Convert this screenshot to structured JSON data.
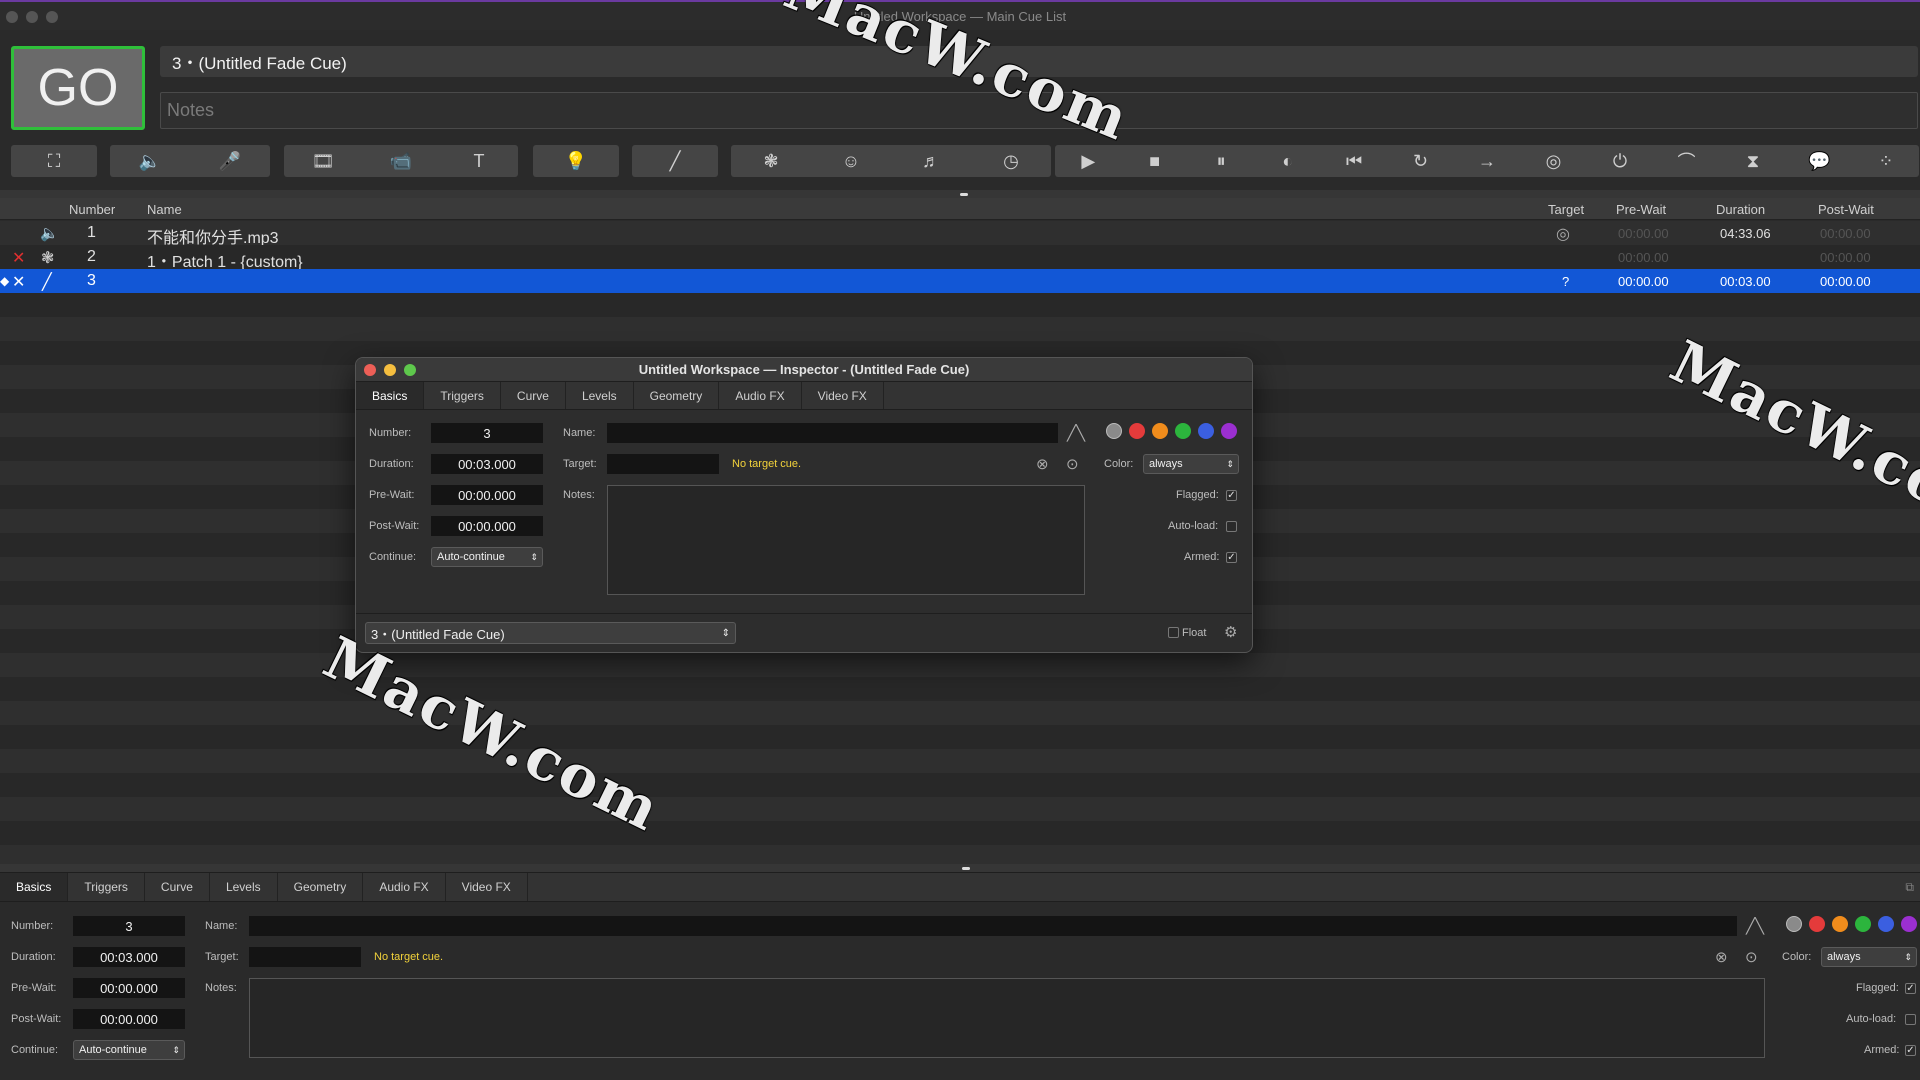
{
  "window": {
    "title": "Untitled Workspace — Main Cue List"
  },
  "go": {
    "label": "GO"
  },
  "current_cue": {
    "title": "3・(Untitled Fade Cue)",
    "notes_placeholder": "Notes"
  },
  "toolbar": {
    "icons": [
      "group",
      "audio",
      "mic",
      "video",
      "camera",
      "text",
      "light",
      "fade",
      "network",
      "midi",
      "music",
      "timecode",
      "start",
      "stop",
      "pause",
      "load",
      "reset",
      "devamp",
      "goto",
      "target",
      "arm",
      "disarm",
      "wait",
      "memo",
      "script"
    ],
    "glyphs": [
      "⛶",
      "🔈",
      "🎤",
      "🎞",
      "📹",
      "T",
      "💡",
      "╱",
      "❃",
      "☺",
      "♬",
      "◷",
      "▶",
      "■",
      "⏸",
      "◐",
      "⏮",
      "↻",
      "→",
      "◎",
      "⏻",
      "⌒",
      "⧗",
      "💬",
      "⁘"
    ]
  },
  "cue_list": {
    "headers": {
      "number": "Number",
      "name": "Name",
      "target": "Target",
      "pre_wait": "Pre-Wait",
      "duration": "Duration",
      "post_wait": "Post-Wait"
    },
    "rows": [
      {
        "number": "1",
        "name": "不能和你分手.mp3",
        "pre_wait": "00:00.00",
        "duration": "04:33.06",
        "post_wait": "00:00.00"
      },
      {
        "number": "2",
        "name": "1・Patch 1 - {custom}",
        "pre_wait": "00:00.00",
        "duration": "",
        "post_wait": "00:00.00"
      },
      {
        "number": "3",
        "name": "",
        "target": "?",
        "pre_wait": "00:00.00",
        "duration": "00:03.00",
        "post_wait": "00:00.00"
      }
    ]
  },
  "inspector_window": {
    "title": "Untitled Workspace — Inspector - (Untitled Fade Cue)",
    "footer_select": "3・(Untitled Fade Cue)",
    "float_label": "Float"
  },
  "tabs": [
    "Basics",
    "Triggers",
    "Curve",
    "Levels",
    "Geometry",
    "Audio FX",
    "Video FX"
  ],
  "basics": {
    "number_label": "Number:",
    "number": "3",
    "duration_label": "Duration:",
    "duration": "00:03.000",
    "prewait_label": "Pre-Wait:",
    "prewait": "00:00.000",
    "postwait_label": "Post-Wait:",
    "postwait": "00:00.000",
    "continue_label": "Continue:",
    "continue": "Auto-continue",
    "name_label": "Name:",
    "target_label": "Target:",
    "no_target": "No target cue.",
    "notes_label": "Notes:",
    "color_label": "Color:",
    "color": "always",
    "flagged_label": "Flagged:",
    "autoload_label": "Auto-load:",
    "armed_label": "Armed:"
  },
  "colors": [
    "#8a8a8a",
    "#e43b3b",
    "#f08c1c",
    "#2cb53d",
    "#3b5fe0",
    "#9b2fd0"
  ],
  "watermarks": [
    "MacW.com",
    "MacW.co",
    "MacW.com"
  ]
}
